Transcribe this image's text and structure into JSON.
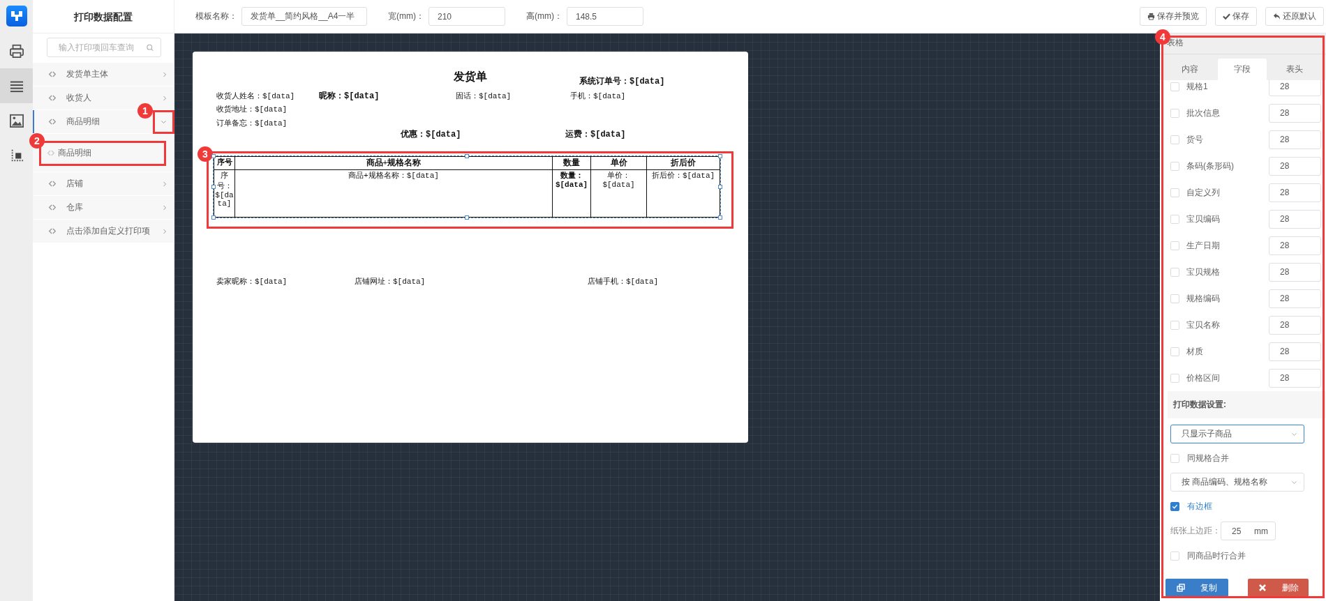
{
  "rail": {
    "items": [
      {
        "kind": "printer",
        "selected": false
      },
      {
        "kind": "list",
        "selected": true
      },
      {
        "kind": "image",
        "selected": false
      },
      {
        "kind": "crop",
        "selected": false
      }
    ]
  },
  "sidebar": {
    "title": "打印数据配置",
    "search": {
      "placeholder": "输入打印项回车查询"
    },
    "items": [
      {
        "label": "发货单主体",
        "expanded": false
      },
      {
        "label": "收货人",
        "expanded": false
      },
      {
        "label": "商品明细",
        "expanded": true,
        "children": [
          {
            "label": "商品明细"
          }
        ]
      },
      {
        "label": "店铺",
        "expanded": false
      },
      {
        "label": "仓库",
        "expanded": false
      },
      {
        "label": "点击添加自定义打印项",
        "expanded": false
      }
    ]
  },
  "toolbar": {
    "fields": [
      {
        "label": "模板名称：",
        "value": "发货单__简约风格__A4一半"
      },
      {
        "label": "宽(mm)：",
        "value": "210"
      },
      {
        "label": "高(mm)：",
        "value": "148.5"
      }
    ],
    "buttons": [
      {
        "kind": "preview",
        "label": "保存并预览"
      },
      {
        "kind": "save",
        "label": "保存"
      },
      {
        "kind": "reset",
        "label": "还原默认"
      }
    ]
  },
  "paper": {
    "title": "发货单",
    "fields": [
      {
        "text": "系统订单号：$[data]",
        "bold": true
      },
      {
        "text": "收货人姓名：$[data]",
        "bold": false
      },
      {
        "text": "昵称：$[data]",
        "bold": true
      },
      {
        "text": "固话：$[data]",
        "bold": false
      },
      {
        "text": "手机：$[data]",
        "bold": false
      },
      {
        "text": "收货地址：$[data]",
        "bold": false
      },
      {
        "text": "订单备忘：$[data]",
        "bold": false
      },
      {
        "text": "优惠：$[data]",
        "bold": true
      },
      {
        "text": "运费：$[data]",
        "bold": true
      },
      {
        "text": "卖家昵称：$[data]",
        "bold": false
      },
      {
        "text": "店铺网址：$[data]",
        "bold": false
      },
      {
        "text": "店铺手机：$[data]",
        "bold": false
      }
    ],
    "table": {
      "columns": [
        "序号",
        "商品+规格名称",
        "数量",
        "单价",
        "折后价"
      ],
      "row": [
        {
          "text": "序号：$[data]",
          "bold": false
        },
        {
          "text": "商品+规格名称：$[data]",
          "bold": false
        },
        {
          "text": "数量：$[data]",
          "bold": true
        },
        {
          "text": "单价：$[data]",
          "bold": false
        },
        {
          "text": "折后价：$[data]",
          "bold": false
        }
      ]
    }
  },
  "panel": {
    "title": "表格",
    "tabs": [
      {
        "label": "内容",
        "selected": false
      },
      {
        "label": "字段",
        "selected": true
      },
      {
        "label": "表头",
        "selected": false
      }
    ],
    "fields": [
      {
        "label": "规格1",
        "checked": false,
        "value": "28"
      },
      {
        "label": "批次信息",
        "checked": false,
        "value": "28"
      },
      {
        "label": "货号",
        "checked": false,
        "value": "28"
      },
      {
        "label": "条码(条形码)",
        "checked": false,
        "value": "28"
      },
      {
        "label": "自定义列",
        "checked": false,
        "value": "28"
      },
      {
        "label": "宝贝编码",
        "checked": false,
        "value": "28"
      },
      {
        "label": "生产日期",
        "checked": false,
        "value": "28"
      },
      {
        "label": "宝贝规格",
        "checked": false,
        "value": "28"
      },
      {
        "label": "规格编码",
        "checked": false,
        "value": "28"
      },
      {
        "label": "宝贝名称",
        "checked": false,
        "value": "28"
      },
      {
        "label": "材质",
        "checked": false,
        "value": "28"
      },
      {
        "label": "价格区间",
        "checked": false,
        "value": "28"
      }
    ],
    "section_title": "打印数据设置:",
    "settings": [
      {
        "kind": "select",
        "value": "只显示子商品",
        "focused": true
      },
      {
        "kind": "checkbox",
        "label": "同规格合并",
        "checked": false
      },
      {
        "kind": "select",
        "value": "按 商品编码、规格名称",
        "focused": false
      },
      {
        "kind": "checkbox",
        "label": "有边框",
        "checked": true
      },
      {
        "kind": "number",
        "label": "纸张上边距：",
        "value": "25",
        "unit": "mm"
      },
      {
        "kind": "checkbox",
        "label": "同商品时行合并",
        "checked": false
      }
    ],
    "buttons": [
      {
        "kind": "copy",
        "label": "复制"
      },
      {
        "kind": "delete",
        "label": "删除"
      }
    ]
  },
  "annotations": [
    {
      "label": "1"
    },
    {
      "label": "2"
    },
    {
      "label": "3"
    },
    {
      "label": "4"
    }
  ]
}
